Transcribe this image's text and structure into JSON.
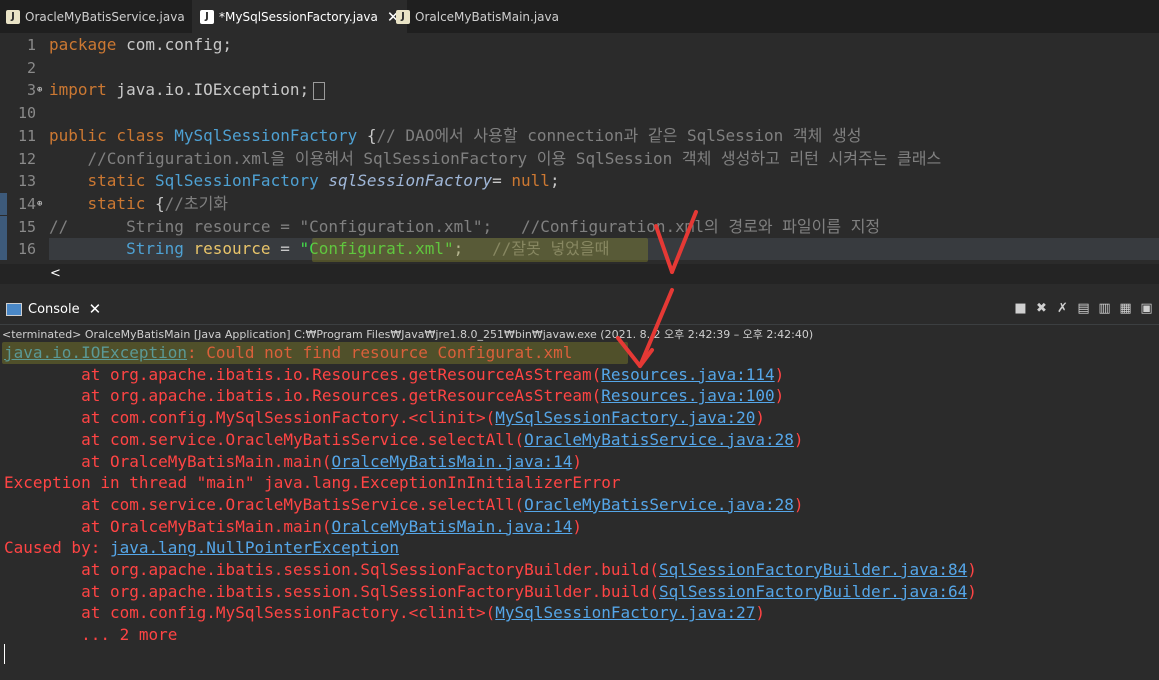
{
  "tabs": [
    {
      "label": "OracleMyBatisService.java",
      "icon": "J"
    },
    {
      "label": "*MySqlSessionFactory.java",
      "icon": "J",
      "close": "✕"
    },
    {
      "label": "OralceMyBatisMain.java",
      "icon": "J"
    }
  ],
  "editor": {
    "lines": [
      {
        "num": "1",
        "parts": [
          [
            "kw",
            "package"
          ],
          [
            "t",
            " com.config;"
          ]
        ]
      },
      {
        "num": "2",
        "parts": []
      },
      {
        "num": "3",
        "parts": [
          [
            "kw",
            "import"
          ],
          [
            "t",
            " java.io.IOException;"
          ]
        ]
      },
      {
        "num": "10",
        "parts": []
      },
      {
        "num": "11",
        "parts": [
          [
            "kw",
            "public class"
          ],
          [
            "t",
            " "
          ],
          [
            "cls",
            "MySqlSessionFactory"
          ],
          [
            "t",
            " {"
          ],
          [
            "cm",
            "// DAO에서 사용할 connection과 같은 SqlSession 객체 생성"
          ]
        ]
      },
      {
        "num": "12",
        "parts": [
          [
            "t",
            "    "
          ],
          [
            "cm",
            "//Configuration.xml을 이용해서 SqlSessionFactory 이용 SqlSession 객체 생성하고 리턴 시켜주는 클래스"
          ]
        ]
      },
      {
        "num": "13",
        "parts": [
          [
            "t",
            "    "
          ],
          [
            "kw",
            "static"
          ],
          [
            "t",
            " "
          ],
          [
            "cls",
            "SqlSessionFactory"
          ],
          [
            "t",
            " "
          ],
          [
            "ital",
            "sqlSessionFactory"
          ],
          [
            "t",
            "= "
          ],
          [
            "kw",
            "null"
          ],
          [
            "t",
            ";"
          ]
        ]
      },
      {
        "num": "14",
        "parts": [
          [
            "t",
            "    "
          ],
          [
            "kw",
            "static"
          ],
          [
            "t",
            " {"
          ],
          [
            "cm",
            "//초기화"
          ]
        ]
      },
      {
        "num": "15",
        "parts": [
          [
            "cm",
            "//      String resource = \"Configuration.xml\";   //Configuration.xml의 경로와 파일이름 지정"
          ]
        ]
      },
      {
        "num": "16",
        "parts": [
          [
            "t",
            "        "
          ],
          [
            "cls",
            "String"
          ],
          [
            "t",
            " "
          ],
          [
            "var",
            "resource"
          ],
          [
            "t",
            " = "
          ],
          [
            "str2",
            "\"Configurat.xml\""
          ],
          [
            "t",
            ";   "
          ],
          [
            "cm",
            "//잘못 넣었을때"
          ]
        ]
      }
    ]
  },
  "console": {
    "tab_label": "Console",
    "close": "✕",
    "terminated": "<terminated> OralceMyBatisMain [Java Application] C:₩Program Files₩Java₩jre1.8.0_251₩bin₩javaw.exe  (2021. 8. 2 오후 2:42:39 – 오후 2:42:40)",
    "lines": [
      [
        [
          "ex",
          "java.io.IOException"
        ],
        [
          "t",
          ": Could not find resource Configurat.xml"
        ]
      ],
      [
        [
          "t",
          "\tat org.apache.ibatis.io.Resources.getResourceAsStream("
        ],
        [
          "lnk",
          "Resources.java:114"
        ],
        [
          "t",
          ")"
        ]
      ],
      [
        [
          "t",
          "\tat org.apache.ibatis.io.Resources.getResourceAsStream("
        ],
        [
          "lnk",
          "Resources.java:100"
        ],
        [
          "t",
          ")"
        ]
      ],
      [
        [
          "t",
          "\tat com.config.MySqlSessionFactory.<clinit>("
        ],
        [
          "lnk",
          "MySqlSessionFactory.java:20"
        ],
        [
          "t",
          ")"
        ]
      ],
      [
        [
          "t",
          "\tat com.service.OracleMyBatisService.selectAll("
        ],
        [
          "lnk",
          "OracleMyBatisService.java:28"
        ],
        [
          "t",
          ")"
        ]
      ],
      [
        [
          "t",
          "\tat OralceMyBatisMain.main("
        ],
        [
          "lnk",
          "OralceMyBatisMain.java:14"
        ],
        [
          "t",
          ")"
        ]
      ],
      [
        [
          "t",
          "Exception in thread \"main\" java.lang.ExceptionInInitializerError"
        ]
      ],
      [
        [
          "t",
          "\tat com.service.OracleMyBatisService.selectAll("
        ],
        [
          "lnk",
          "OracleMyBatisService.java:28"
        ],
        [
          "t",
          ")"
        ]
      ],
      [
        [
          "t",
          "\tat OralceMyBatisMain.main("
        ],
        [
          "lnk",
          "OralceMyBatisMain.java:14"
        ],
        [
          "t",
          ")"
        ]
      ],
      [
        [
          "t",
          "Caused by: "
        ],
        [
          "lnk",
          "java.lang.NullPointerException"
        ]
      ],
      [
        [
          "t",
          "\tat org.apache.ibatis.session.SqlSessionFactoryBuilder.build("
        ],
        [
          "lnk",
          "SqlSessionFactoryBuilder.java:84"
        ],
        [
          "t",
          ")"
        ]
      ],
      [
        [
          "t",
          "\tat org.apache.ibatis.session.SqlSessionFactoryBuilder.build("
        ],
        [
          "lnk",
          "SqlSessionFactoryBuilder.java:64"
        ],
        [
          "t",
          ")"
        ]
      ],
      [
        [
          "t",
          "\tat com.config.MySqlSessionFactory.<clinit>("
        ],
        [
          "lnk",
          "MySqlSessionFactory.java:27"
        ],
        [
          "t",
          ")"
        ]
      ],
      [
        [
          "t",
          "\t... 2 more"
        ]
      ]
    ]
  },
  "colors": {
    "error": "#ff4444",
    "link": "#55a6e8",
    "keyword": "#cc7832",
    "annotation": "#e53935"
  }
}
